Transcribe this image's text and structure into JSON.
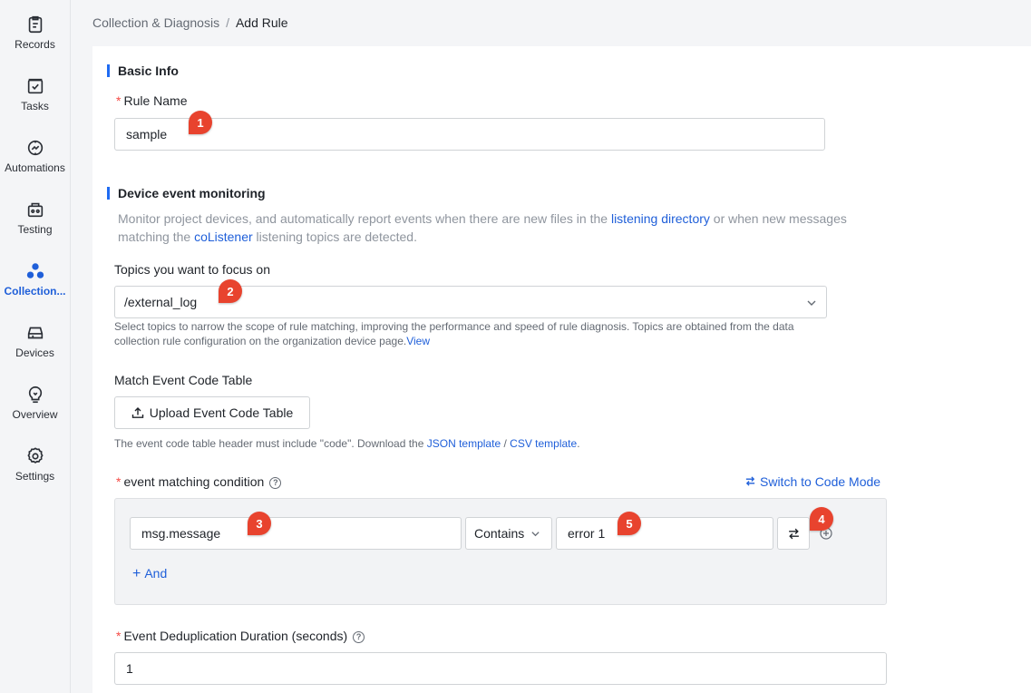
{
  "sidebar": {
    "items": [
      {
        "label": "Records",
        "icon": "clipboard-icon"
      },
      {
        "label": "Tasks",
        "icon": "task-check-icon"
      },
      {
        "label": "Automations",
        "icon": "automation-icon"
      },
      {
        "label": "Testing",
        "icon": "testing-icon"
      },
      {
        "label": "Collection...",
        "icon": "collection-icon",
        "active": true
      },
      {
        "label": "Devices",
        "icon": "device-icon"
      },
      {
        "label": "Overview",
        "icon": "overview-icon"
      },
      {
        "label": "Settings",
        "icon": "gear-icon"
      }
    ]
  },
  "breadcrumb": {
    "parent": "Collection & Diagnosis",
    "separator": "/",
    "current": "Add Rule"
  },
  "basic_info": {
    "title": "Basic Info",
    "rule_name_label": "Rule Name",
    "rule_name_value": "sample"
  },
  "monitoring": {
    "title": "Device event monitoring",
    "desc_part1": "Monitor project devices, and automatically report events when there are new files in the",
    "desc_link1": "listening directory",
    "desc_part2": "or when new messages",
    "desc_part3": "matching the",
    "desc_link2": "coListener",
    "desc_part4": "listening topics are detected.",
    "topics_label": "Topics you want to focus on",
    "topics_value": "/external_log",
    "topics_hint_line1": "Select topics to narrow the scope of rule matching, improving the performance and speed of rule diagnosis. Topics are obtained from the data",
    "topics_hint_line2": "collection rule configuration on the organization device page.",
    "topics_hint_link": "View",
    "event_table_label": "Match Event Code Table",
    "upload_button": "Upload Event Code Table",
    "event_table_hint": "The event code table header must include \"code\". Download the",
    "json_template": "JSON template",
    "template_sep": "/",
    "csv_template": "CSV template",
    "hint_end": ".",
    "condition_label": "event matching condition",
    "switch_mode": "Switch to Code Mode",
    "condition": {
      "field": "msg.message",
      "operator": "Contains",
      "value": "error 1"
    },
    "add_and": "And",
    "dedup_label": "Event Deduplication Duration (seconds)",
    "dedup_value": "1"
  },
  "badges": [
    "1",
    "2",
    "3",
    "4",
    "5"
  ],
  "colors": {
    "accent": "#1f5fd9",
    "badge": "#e8432e",
    "required": "#f54a45"
  }
}
